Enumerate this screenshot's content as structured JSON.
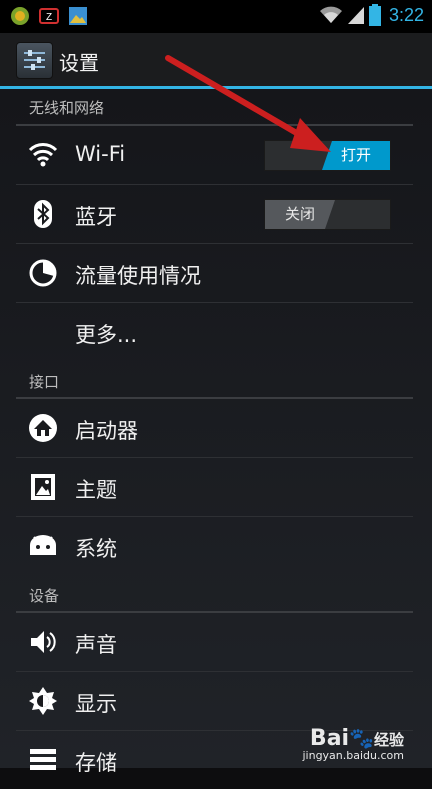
{
  "status_bar": {
    "time": "3:22",
    "left_icons": [
      "app-notification-icon",
      "z-notification-icon",
      "gallery-notification-icon"
    ],
    "right_icons": [
      "wifi-signal-icon",
      "cell-signal-icon",
      "battery-icon"
    ]
  },
  "action_bar": {
    "title": "设置",
    "icon": "settings-app-icon",
    "accent_color": "#33b5e5"
  },
  "sections": {
    "wireless": "无线和网络",
    "interface": "接口",
    "device": "设备"
  },
  "items": {
    "wifi": {
      "label": "Wi-Fi",
      "icon": "wifi-icon",
      "toggle": "打开",
      "state": "on"
    },
    "bluetooth": {
      "label": "蓝牙",
      "icon": "bluetooth-icon",
      "toggle": "关闭",
      "state": "off"
    },
    "data_usage": {
      "label": "流量使用情况",
      "icon": "data-usage-icon"
    },
    "more": {
      "label": "更多..."
    },
    "launcher": {
      "label": "启动器",
      "icon": "launcher-icon"
    },
    "theme": {
      "label": "主题",
      "icon": "theme-icon"
    },
    "system": {
      "label": "系统",
      "icon": "system-icon"
    },
    "sound": {
      "label": "声音",
      "icon": "sound-icon"
    },
    "display": {
      "label": "显示",
      "icon": "display-icon"
    },
    "storage": {
      "label": "存储",
      "icon": "storage-icon"
    }
  },
  "annotation": {
    "type": "red-arrow",
    "points_to": "wifi-toggle",
    "color": "#cc1f1f"
  },
  "watermark": {
    "brand": "Bai",
    "site_label": "经验",
    "url": "jingyan.baidu.com"
  }
}
